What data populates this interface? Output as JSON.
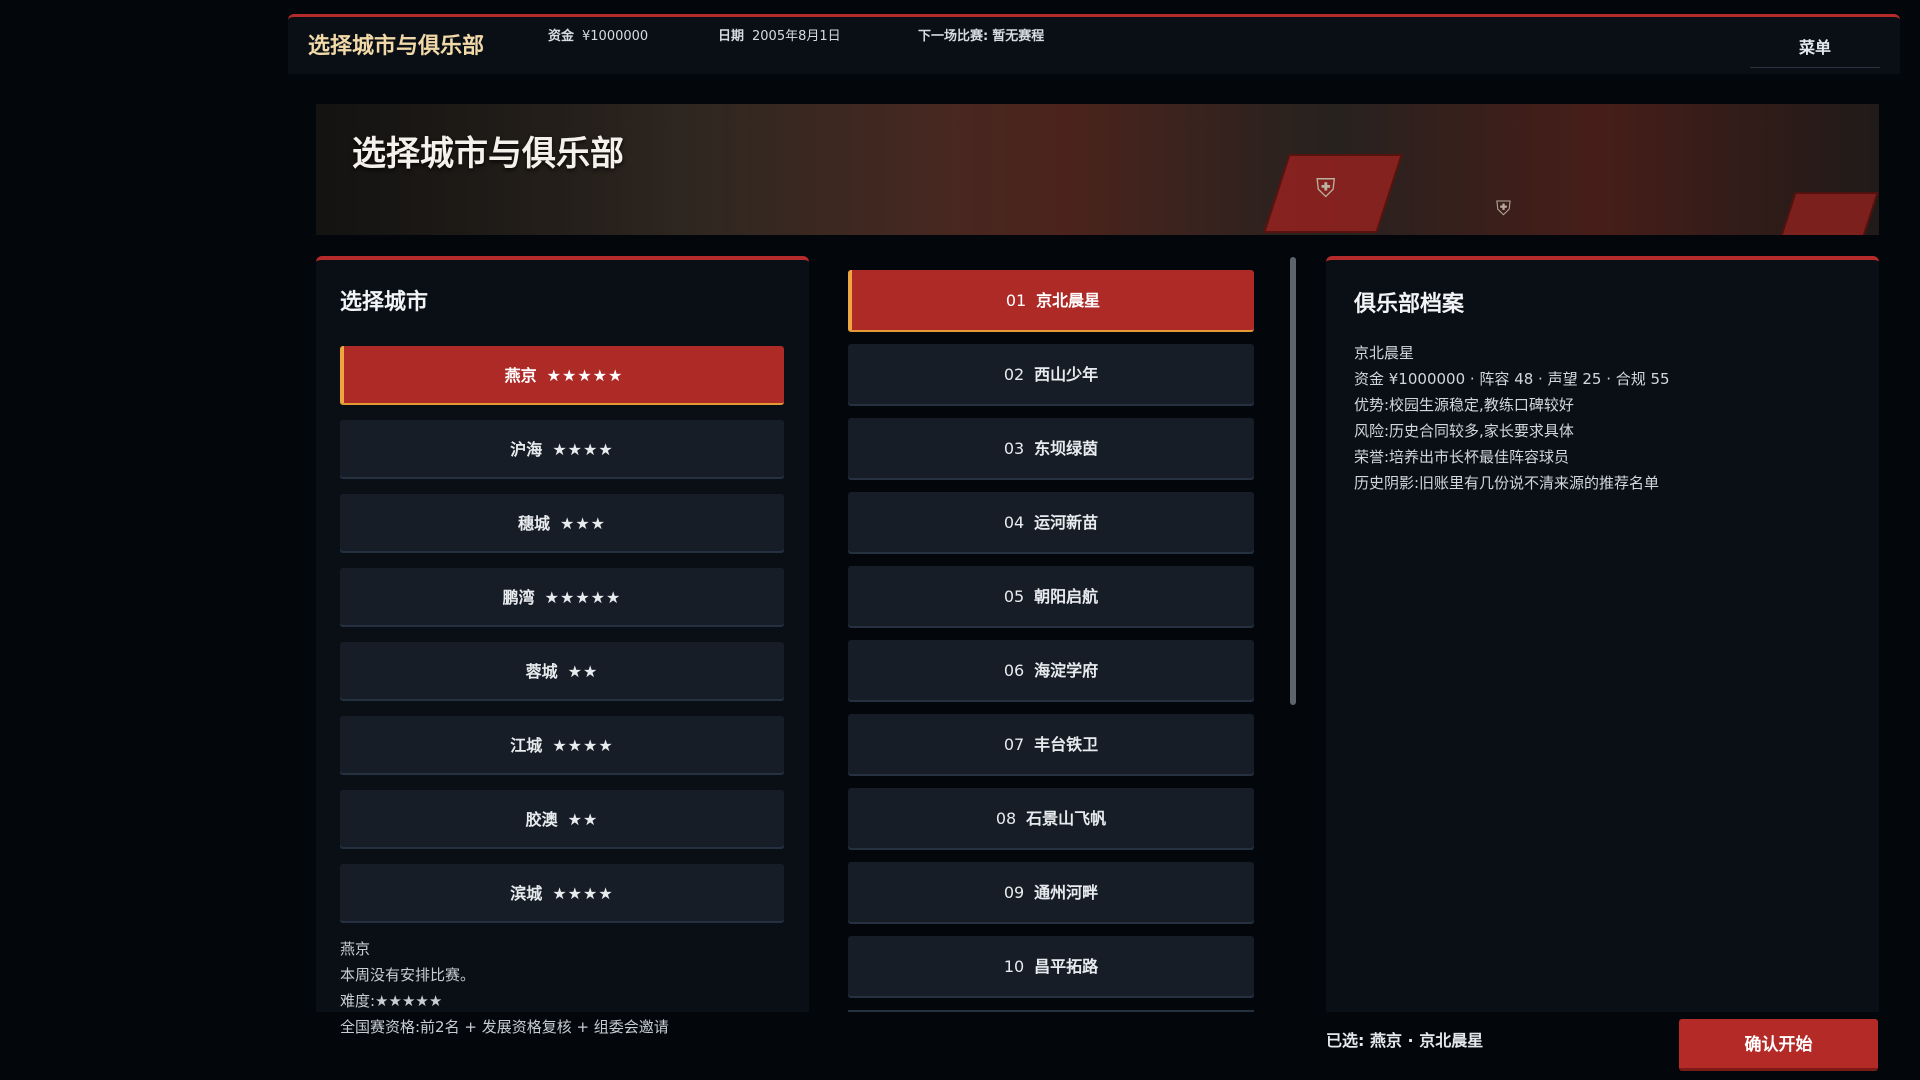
{
  "topbar": {
    "title": "选择城市与俱乐部",
    "funds_label": "资金",
    "funds_value": "¥1000000",
    "date_label": "日期",
    "date_value": "2005年8月1日",
    "next_match_label": "下一场比赛:",
    "next_match_value": "暂无赛程",
    "menu_label": "菜单"
  },
  "banner": {
    "title": "选择城市与俱乐部"
  },
  "city_panel": {
    "title": "选择城市",
    "cities": [
      {
        "name": "燕京",
        "stars": "★★★★★",
        "active": true
      },
      {
        "name": "沪海",
        "stars": "★★★★",
        "active": false
      },
      {
        "name": "穗城",
        "stars": "★★★",
        "active": false
      },
      {
        "name": "鹏湾",
        "stars": "★★★★★",
        "active": false
      },
      {
        "name": "蓉城",
        "stars": "★★",
        "active": false
      },
      {
        "name": "江城",
        "stars": "★★★★",
        "active": false
      },
      {
        "name": "胶澳",
        "stars": "★★",
        "active": false
      },
      {
        "name": "滨城",
        "stars": "★★★★",
        "active": false
      }
    ],
    "info": {
      "city": "燕京",
      "schedule": "本周没有安排比赛。",
      "difficulty": "难度:★★★★★",
      "qualification": "全国赛资格:前2名 + 发展资格复核 + 组委会邀请"
    }
  },
  "club_list": {
    "clubs": [
      {
        "num": "01",
        "name": "京北晨星",
        "active": true
      },
      {
        "num": "02",
        "name": "西山少年",
        "active": false
      },
      {
        "num": "03",
        "name": "东坝绿茵",
        "active": false
      },
      {
        "num": "04",
        "name": "运河新苗",
        "active": false
      },
      {
        "num": "05",
        "name": "朝阳启航",
        "active": false
      },
      {
        "num": "06",
        "name": "海淀学府",
        "active": false
      },
      {
        "num": "07",
        "name": "丰台铁卫",
        "active": false
      },
      {
        "num": "08",
        "name": "石景山飞帆",
        "active": false
      },
      {
        "num": "09",
        "name": "通州河畔",
        "active": false
      },
      {
        "num": "10",
        "name": "昌平拓路",
        "active": false
      }
    ]
  },
  "profile_panel": {
    "title": "俱乐部档案",
    "club_name": "京北晨星",
    "stats": "资金 ¥1000000 · 阵容 48 · 声望 25 · 合规 55",
    "strength": "优势:校园生源稳定,教练口碑较好",
    "risk": "风险:历史合同较多,家长要求具体",
    "honor": "荣誉:培养出市长杯最佳阵容球员",
    "shadow": "历史阴影:旧账里有几份说不清来源的推荐名单"
  },
  "footer": {
    "selected": "已选: 燕京 · 京北晨星",
    "confirm_label": "确认开始"
  },
  "colors": {
    "accent_red": "#b52a2a",
    "active_border": "#f0a640",
    "panel_bg": "#0a0f16",
    "button_bg": "#161d27"
  }
}
